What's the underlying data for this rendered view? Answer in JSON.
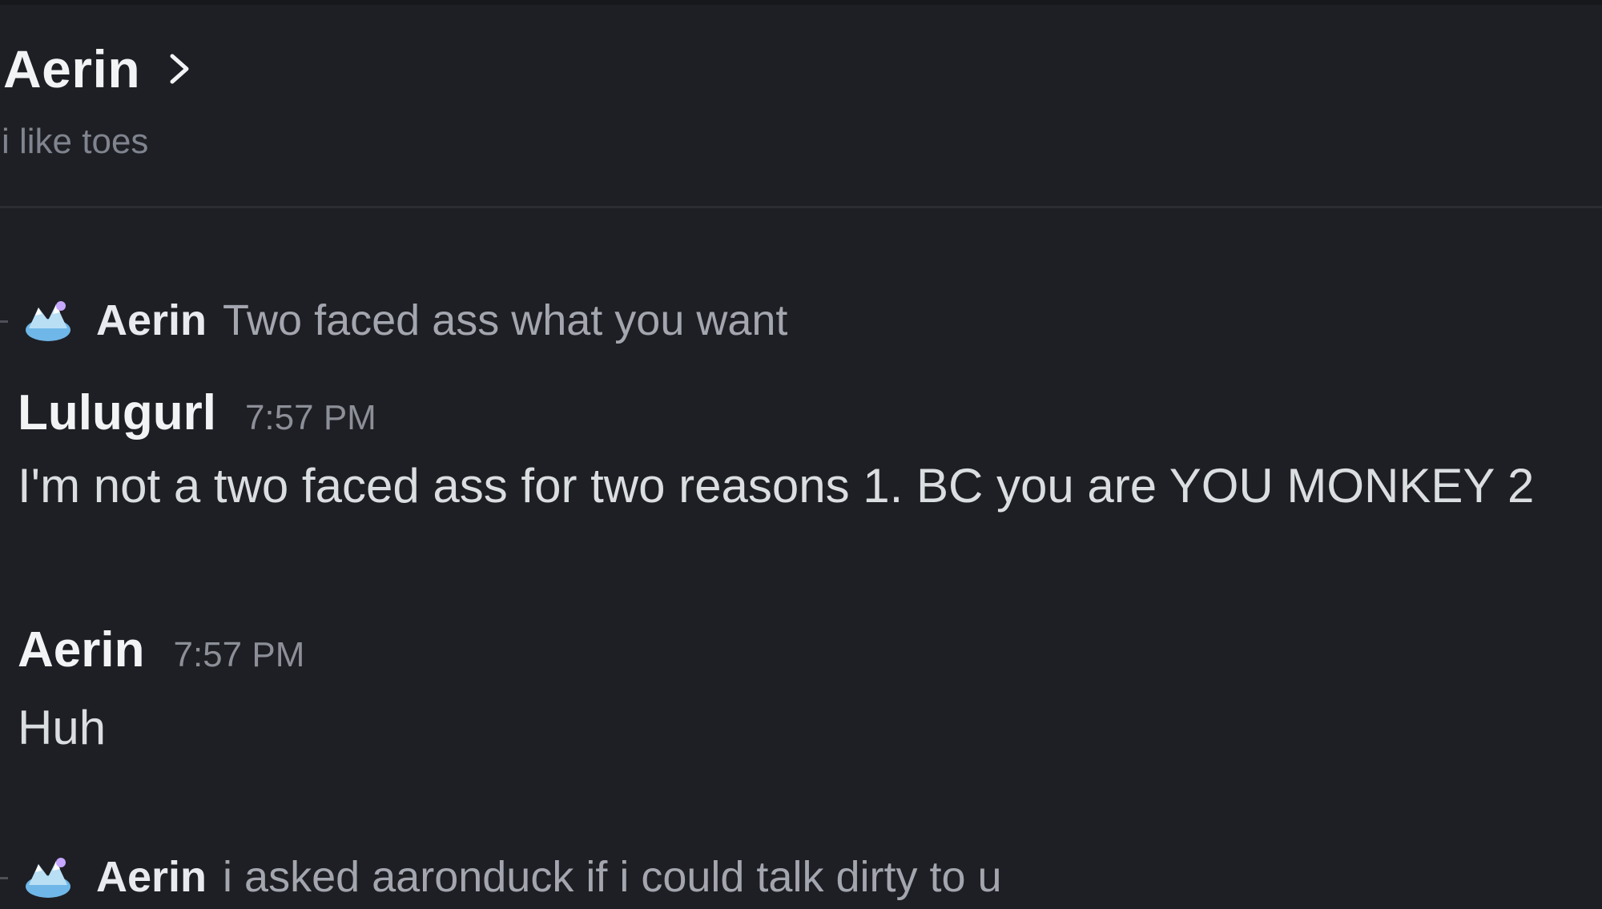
{
  "header": {
    "title": "Aerin",
    "status": "i like toes"
  },
  "messages": [
    {
      "reply": {
        "author": "Aerin",
        "text": "Two faced ass what you want"
      },
      "author": "Lulugurl",
      "time": "7:57 PM",
      "text": "I'm not a two faced ass for two reasons 1. BC you are YOU MONKEY 2"
    },
    {
      "author": "Aerin",
      "time": "7:57 PM",
      "text": "Huh"
    },
    {
      "reply": {
        "author": "Aerin",
        "text": "i asked aaronduck if i could talk dirty to u"
      }
    }
  ],
  "colors": {
    "background": "#1e1f24",
    "divider": "#2b2d33",
    "name": "#f2f3f5",
    "muted": "#80848e",
    "message": "#dbdee1"
  },
  "icons": {
    "title_chevron": "chevron-right-icon",
    "reply_avatar": "avatar-icon"
  }
}
